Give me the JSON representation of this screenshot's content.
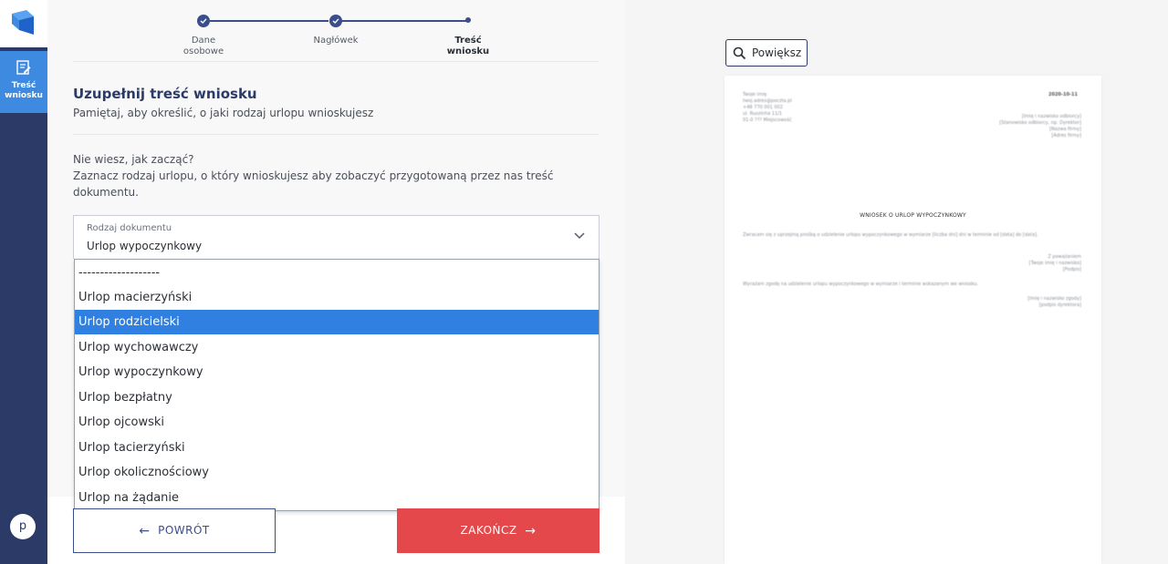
{
  "sidebar": {
    "nav_item_label": "Treść\nwniosku",
    "avatar_letter": "p"
  },
  "stepper": {
    "steps": [
      {
        "label": "Dane\nosobowe",
        "state": "done"
      },
      {
        "label": "Nagłówek",
        "state": "done"
      },
      {
        "label": "Treść\nwniosku",
        "state": "current"
      }
    ]
  },
  "form": {
    "title": "Uzupełnij treść wniosku",
    "subtitle": "Pamiętaj, aby określić, o jaki rodzaj urlopu wnioskujesz",
    "help_question": "Nie wiesz, jak zacząć?",
    "help_text": "Zaznacz rodzaj urlopu, o który wnioskujesz aby zobaczyć przygotowaną przez nas treść dokumentu.",
    "select": {
      "label": "Rodzaj dokumentu",
      "value": "Urlop wypoczynkowy"
    },
    "dropdown_options": [
      "-------------------",
      "Urlop macierzyński",
      "Urlop rodzicielski",
      "Urlop wychowawczy",
      "Urlop wypoczynkowy",
      "Urlop bezpłatny",
      "Urlop ojcowski",
      "Urlop tacierzyński",
      "Urlop okolicznościowy",
      "Urlop na żądanie"
    ],
    "highlighted_option": "Urlop rodzicielski"
  },
  "buttons": {
    "back_label": "POWRÓT",
    "finish_label": "ZAKOŃCZ"
  },
  "preview": {
    "zoom_label": "Powiększ",
    "document_title": "WNIOSEK O URLOP WYPOCZYNKOWY"
  },
  "colors": {
    "sidebar": "#2b3a67",
    "accent_blue": "#3d8ae0",
    "highlight": "#2f80e0",
    "finish_button": "#e5484b"
  }
}
